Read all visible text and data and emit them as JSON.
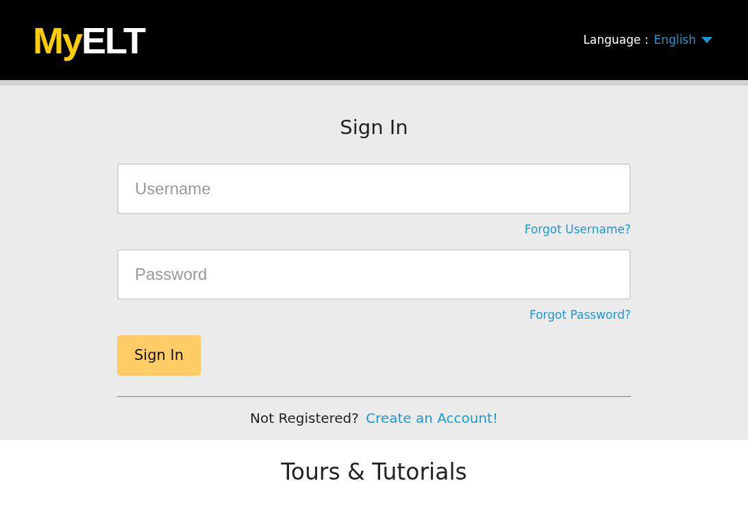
{
  "header": {
    "logo": {
      "accent": "My",
      "rest": "ELT"
    },
    "language_label": "Language :",
    "language_value": "English"
  },
  "sign_in": {
    "title": "Sign In",
    "fields": [
      {
        "placeholder": "Username",
        "link": "Forgot Username?"
      },
      {
        "placeholder": "Password",
        "link": "Forgot Password?"
      }
    ],
    "button": "Sign In",
    "register_prompt": "Not Registered?",
    "register_link": "Create an Account!"
  },
  "tours": {
    "title": "Tours & Tutorials"
  }
}
